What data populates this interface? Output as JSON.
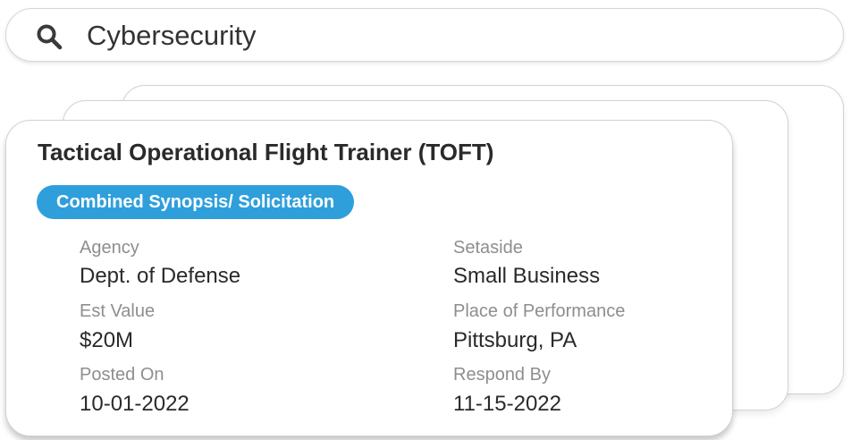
{
  "search": {
    "query": "Cybersecurity",
    "icon": "search-icon"
  },
  "card": {
    "title": "Tactical Operational Flight Trainer (TOFT)",
    "badge": "Combined Synopsis/ Solicitation",
    "badge_color": "#2f9fdc",
    "fields": {
      "agency": {
        "label": "Agency",
        "value": "Dept. of Defense"
      },
      "setaside": {
        "label": "Setaside",
        "value": "Small Business"
      },
      "est_value": {
        "label": "Est Value",
        "value": "$20M"
      },
      "place_of_performance": {
        "label": "Place of Performance",
        "value": "Pittsburg, PA"
      },
      "posted_on": {
        "label": "Posted On",
        "value": "10-01-2022"
      },
      "respond_by": {
        "label": "Respond By",
        "value": "11-15-2022"
      }
    }
  }
}
